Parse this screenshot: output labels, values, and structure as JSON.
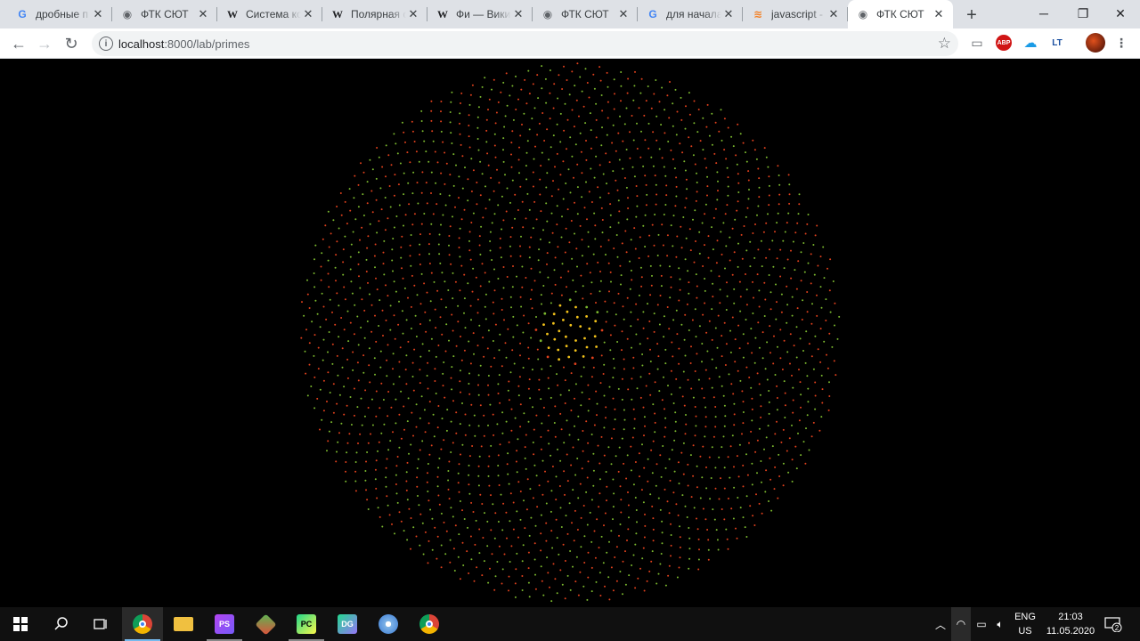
{
  "browser": {
    "tabs": [
      {
        "icon": "google-icon",
        "title": "дробные п",
        "active": false
      },
      {
        "icon": "globe-icon",
        "title": "ФТК СЮТ",
        "active": false
      },
      {
        "icon": "wikipedia-icon",
        "title": "Система ко",
        "active": false
      },
      {
        "icon": "wikipedia-icon",
        "title": "Полярная с",
        "active": false
      },
      {
        "icon": "wikipedia-icon",
        "title": "Фи — Вики",
        "active": false
      },
      {
        "icon": "globe-icon",
        "title": "ФТК СЮТ",
        "active": false
      },
      {
        "icon": "google-icon",
        "title": "для начала",
        "active": false
      },
      {
        "icon": "stackoverflow-icon",
        "title": "javascript -",
        "active": false
      },
      {
        "icon": "globe-icon",
        "title": "ФТК СЮТ",
        "active": true
      }
    ],
    "address": {
      "host": "localhost",
      "rest": ":8000/lab/primes"
    }
  },
  "visualization": {
    "description_colors": {
      "background": "#000000",
      "dot_a": "#e0401c",
      "dot_b": "#7bb82e",
      "center": "#f2c21a"
    },
    "spiral": {
      "point_count": 2400,
      "golden_angle_deg": 137.508
    }
  },
  "taskbar": {
    "apps": [
      {
        "icon": "chrome-icon",
        "active": true
      },
      {
        "icon": "file-explorer-icon",
        "active": false
      },
      {
        "icon": "phpstorm-icon",
        "active": false
      },
      {
        "icon": "git-icon",
        "active": false
      },
      {
        "icon": "pycharm-icon",
        "active": false
      },
      {
        "icon": "datagrip-icon",
        "active": false
      },
      {
        "icon": "paint-icon",
        "active": false
      },
      {
        "icon": "chrome-icon",
        "active": false
      }
    ],
    "language_top": "ENG",
    "language_bottom": "US",
    "time": "21:03",
    "date": "11.05.2020",
    "notification_count": "2"
  }
}
